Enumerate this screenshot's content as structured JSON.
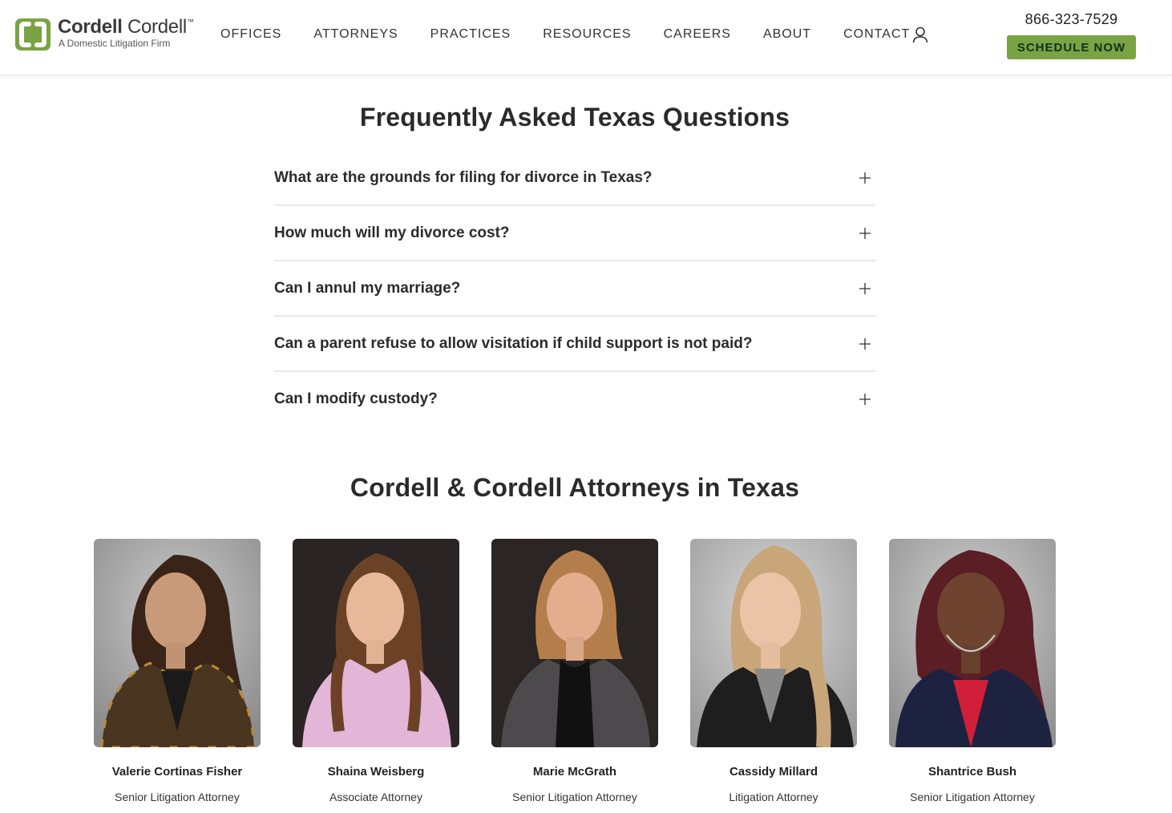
{
  "header": {
    "logo": {
      "name_bold": "Cordell",
      "name_regular": "Cordell",
      "trademark": "™",
      "tagline": "A Domestic Litigation Firm",
      "brand_color": "#7aa343"
    },
    "nav": [
      {
        "label": "OFFICES"
      },
      {
        "label": "ATTORNEYS"
      },
      {
        "label": "PRACTICES"
      },
      {
        "label": "RESOURCES"
      },
      {
        "label": "CAREERS"
      },
      {
        "label": "ABOUT"
      },
      {
        "label": "CONTACT"
      }
    ],
    "user_icon": "user-icon",
    "phone": "866-323-7529",
    "cta_label": "SCHEDULE NOW",
    "cta_color": "#7aa343"
  },
  "faq": {
    "title": "Frequently Asked Texas Questions",
    "expand_icon": "plus-icon",
    "items": [
      {
        "question": "What are the grounds for filing for divorce in Texas?"
      },
      {
        "question": "How much will my divorce cost?"
      },
      {
        "question": "Can I annul my marriage?"
      },
      {
        "question": "Can a parent refuse to allow visitation if child support is not paid?"
      },
      {
        "question": "Can I modify custody?"
      }
    ]
  },
  "attorneys": {
    "title": "Cordell & Cordell Attorneys in Texas",
    "items": [
      {
        "name": "Valerie Cortinas Fisher",
        "role": "Senior Litigation Attorney"
      },
      {
        "name": "Shaina Weisberg",
        "role": "Associate Attorney"
      },
      {
        "name": "Marie McGrath",
        "role": "Senior Litigation Attorney"
      },
      {
        "name": "Cassidy Millard",
        "role": "Litigation Attorney"
      },
      {
        "name": "Shantrice Bush",
        "role": "Senior Litigation Attorney"
      }
    ]
  }
}
